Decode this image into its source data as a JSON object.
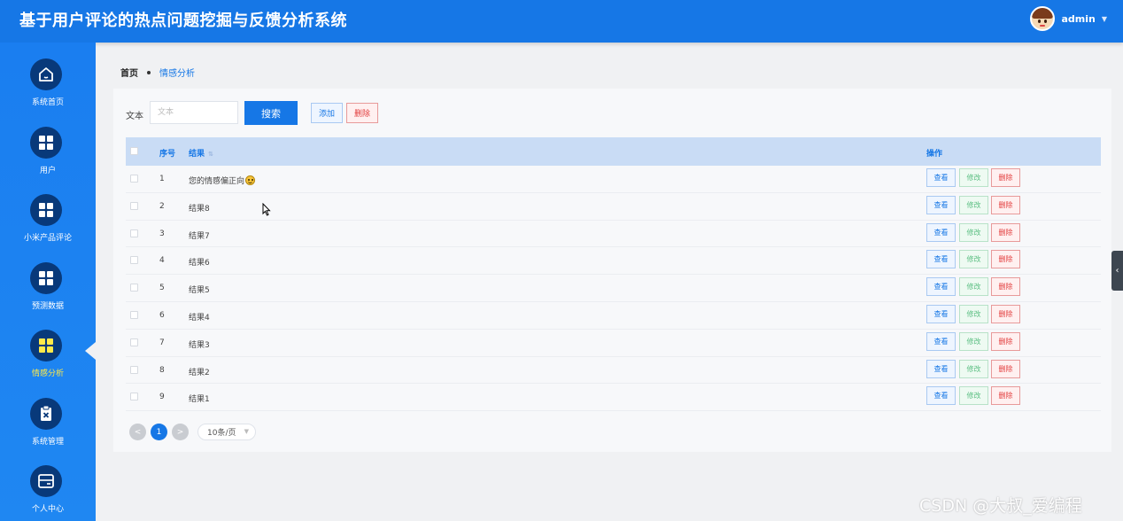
{
  "header": {
    "title": "基于用户评论的热点问题挖掘与反馈分析系统",
    "user": "admin"
  },
  "sidebar": {
    "items": [
      {
        "label": "系统首页",
        "icon": "home-icon"
      },
      {
        "label": "用户",
        "icon": "grid-icon"
      },
      {
        "label": "小米产品评论",
        "icon": "grid-icon"
      },
      {
        "label": "预测数据",
        "icon": "grid-icon"
      },
      {
        "label": "情感分析",
        "icon": "grid-icon",
        "active": true
      },
      {
        "label": "系统管理",
        "icon": "clipboard-icon"
      },
      {
        "label": "个人中心",
        "icon": "card-icon"
      }
    ]
  },
  "breadcrumb": {
    "home": "首页",
    "current": "情感分析"
  },
  "search": {
    "label": "文本",
    "placeholder": "文本",
    "button": "搜索"
  },
  "toolbar": {
    "add": "添加",
    "delete": "删除"
  },
  "table": {
    "columns": {
      "index": "序号",
      "result": "结果",
      "actions": "操作"
    },
    "rows": [
      {
        "index": "1",
        "result": "您的情感偏正向"
      },
      {
        "index": "2",
        "result": "结果8"
      },
      {
        "index": "3",
        "result": "结果7"
      },
      {
        "index": "4",
        "result": "结果6"
      },
      {
        "index": "5",
        "result": "结果5"
      },
      {
        "index": "6",
        "result": "结果4"
      },
      {
        "index": "7",
        "result": "结果3"
      },
      {
        "index": "8",
        "result": "结果2"
      },
      {
        "index": "9",
        "result": "结果1"
      }
    ],
    "actions": {
      "view": "查看",
      "edit": "修改",
      "delete": "删除"
    }
  },
  "pagination": {
    "prev": "<",
    "current": "1",
    "next": ">",
    "page_size": "10条/页"
  },
  "watermark": "CSDN @大叔_爱编程",
  "colors": {
    "primary": "#1677e6",
    "sidebar_circle": "#08397a",
    "active": "#ffe94a",
    "danger": "#e23b3b",
    "success": "#5bbf82"
  }
}
